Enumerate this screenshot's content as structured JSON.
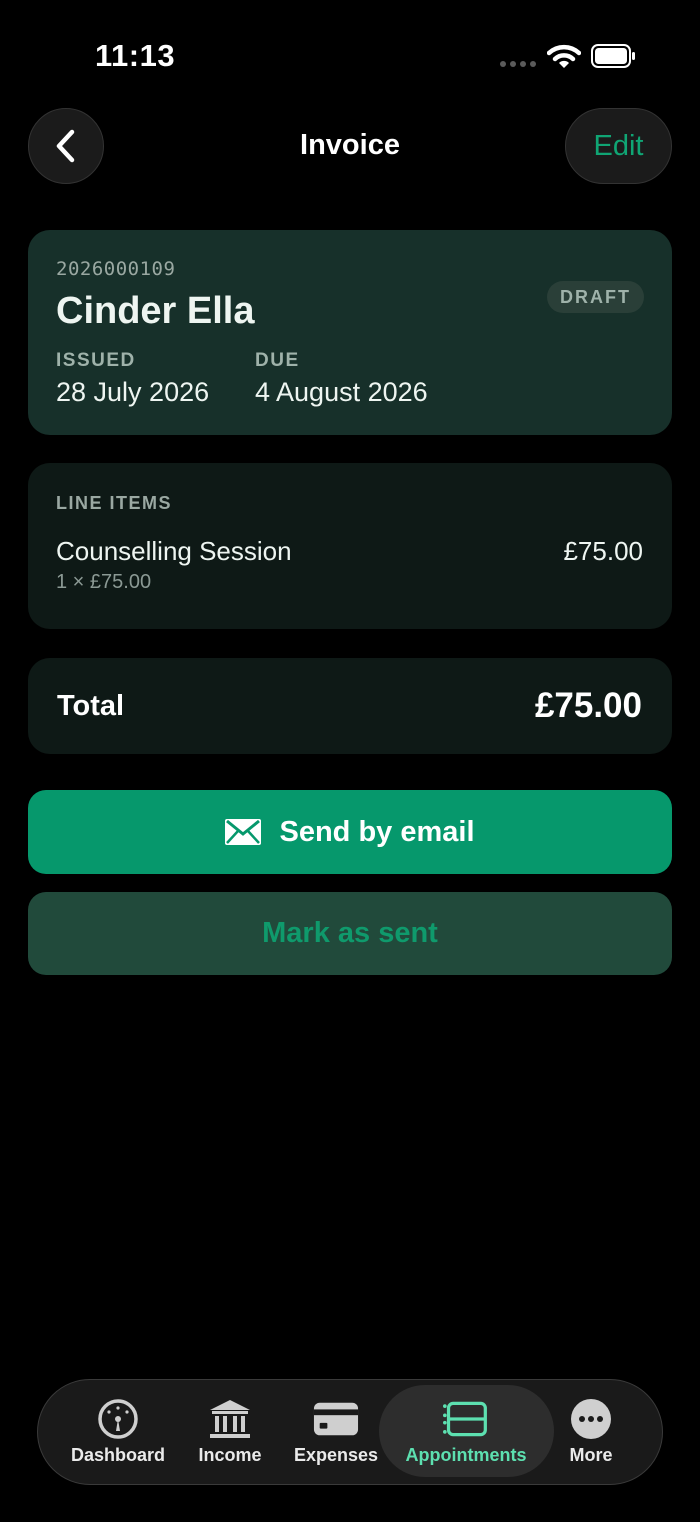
{
  "status_bar": {
    "time": "11:13"
  },
  "header": {
    "title": "Invoice",
    "edit_label": "Edit"
  },
  "invoice": {
    "number": "2026000109",
    "client": "Cinder Ella",
    "status": "DRAFT",
    "issued_label": "ISSUED",
    "issued_date": "28 July 2026",
    "due_label": "DUE",
    "due_date": "4 August 2026"
  },
  "line_items": {
    "heading": "LINE ITEMS",
    "items": [
      {
        "name": "Counselling Session",
        "detail": "1 × £75.00",
        "amount": "£75.00"
      }
    ]
  },
  "total": {
    "label": "Total",
    "amount": "£75.00"
  },
  "actions": {
    "send_label": "Send by email",
    "mark_label": "Mark as sent"
  },
  "tabbar": {
    "active": "Appointments",
    "items": [
      {
        "label": "Dashboard",
        "icon": "gauge-icon"
      },
      {
        "label": "Income",
        "icon": "bank-icon"
      },
      {
        "label": "Expenses",
        "icon": "credit-card-icon"
      },
      {
        "label": "Appointments",
        "icon": "appointments-icon"
      },
      {
        "label": "More",
        "icon": "more-icon"
      }
    ]
  },
  "colors": {
    "accent": "#06986c",
    "accent_text": "#10a574",
    "active_tab": "#5de0b0",
    "card_main": "#17302a",
    "card_dark": "#0e1916"
  }
}
